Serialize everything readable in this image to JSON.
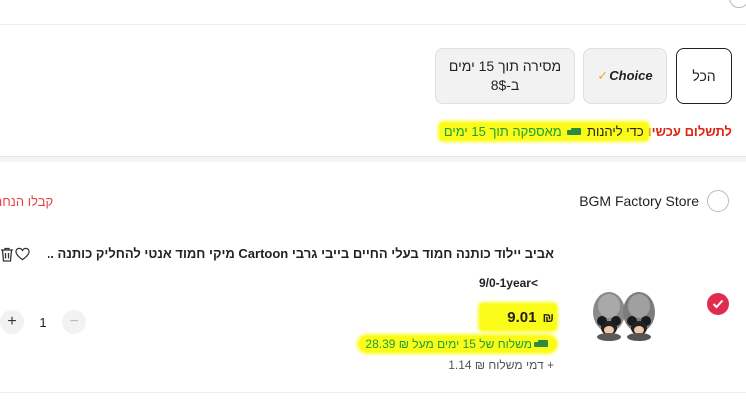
{
  "filters": [
    {
      "label": "הכל",
      "selected": true
    },
    {
      "label": "Choice",
      "selected": false
    },
    {
      "label_line1": "מסירה תוך 15 ימים",
      "label_line2": "ב-8$",
      "selected": false
    }
  ],
  "promo": {
    "pay_now": "לתשלום עכשיו",
    "to_enjoy": "כדי ליהנות",
    "delivery": "מאספקה תוך 15 ימים"
  },
  "store": {
    "name": "BGM Factory Store",
    "coupon_link": "קבלו הנחה"
  },
  "item": {
    "title": "אביב יילוד כותנה חמוד בעלי החיים בייבי גרבי Cartoon מיקי חמוד אנטי להחליק כותנה ...",
    "variant": "9/0-1year",
    "variant_chevron": "<",
    "price": "9.01",
    "currency": "₪",
    "quantity": "1",
    "plus": "+",
    "minus": "−",
    "shipping_fast": "משלוח של 15 ימים מעל ₪ 28.39",
    "shipping_fee": "+ דמי משלוח ₪ 1.14",
    "selected": true
  },
  "icons": {
    "truck": "truck-icon",
    "trash": "trash-icon",
    "heart": "heart-icon",
    "check": "check-icon"
  },
  "colors": {
    "accent_red": "#e02c4f",
    "promo_red": "#e0230f",
    "green": "#1a9f3a",
    "highlight": "#fbfb1a"
  }
}
